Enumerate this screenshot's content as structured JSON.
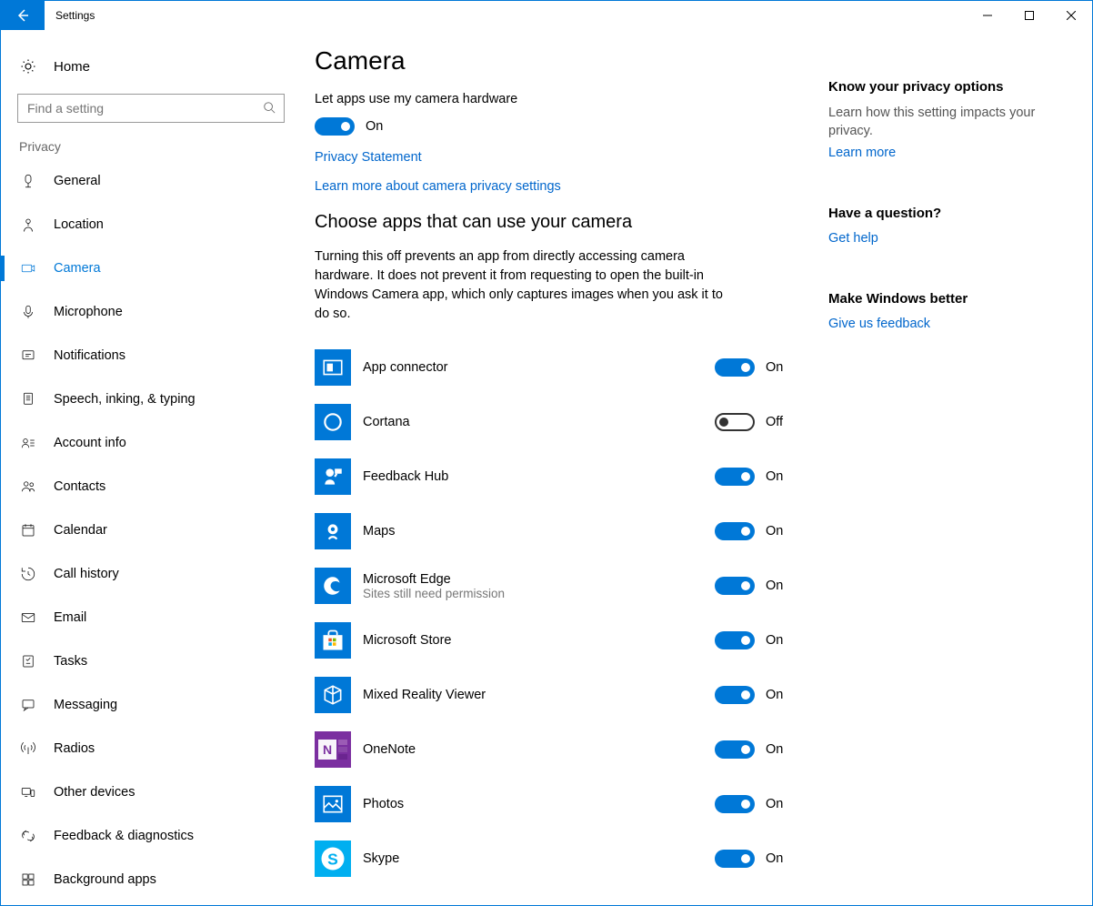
{
  "window": {
    "title": "Settings"
  },
  "sidebar": {
    "home": "Home",
    "search_placeholder": "Find a setting",
    "section": "Privacy",
    "items": [
      {
        "id": "general",
        "label": "General"
      },
      {
        "id": "location",
        "label": "Location"
      },
      {
        "id": "camera",
        "label": "Camera",
        "active": true
      },
      {
        "id": "microphone",
        "label": "Microphone"
      },
      {
        "id": "notifications",
        "label": "Notifications"
      },
      {
        "id": "speech",
        "label": "Speech, inking, & typing"
      },
      {
        "id": "accountinfo",
        "label": "Account info"
      },
      {
        "id": "contacts",
        "label": "Contacts"
      },
      {
        "id": "calendar",
        "label": "Calendar"
      },
      {
        "id": "callhistory",
        "label": "Call history"
      },
      {
        "id": "email",
        "label": "Email"
      },
      {
        "id": "tasks",
        "label": "Tasks"
      },
      {
        "id": "messaging",
        "label": "Messaging"
      },
      {
        "id": "radios",
        "label": "Radios"
      },
      {
        "id": "otherdevices",
        "label": "Other devices"
      },
      {
        "id": "feedback",
        "label": "Feedback & diagnostics"
      },
      {
        "id": "background",
        "label": "Background apps"
      }
    ]
  },
  "main": {
    "title": "Camera",
    "master_label": "Let apps use my camera hardware",
    "master_state": "On",
    "privacy_link": "Privacy Statement",
    "learn_link": "Learn more about camera privacy settings",
    "subhead": "Choose apps that can use your camera",
    "desc": "Turning this off prevents an app from directly accessing camera hardware. It does not prevent it from requesting to open the built-in Windows Camera app, which only captures images when you ask it to do so.",
    "apps": [
      {
        "name": "App connector",
        "state": "On",
        "color": "#0078d7"
      },
      {
        "name": "Cortana",
        "state": "Off",
        "color": "#0078d7"
      },
      {
        "name": "Feedback Hub",
        "state": "On",
        "color": "#0078d7"
      },
      {
        "name": "Maps",
        "state": "On",
        "color": "#0078d7"
      },
      {
        "name": "Microsoft Edge",
        "sub": "Sites still need permission",
        "state": "On",
        "color": "#0078d7"
      },
      {
        "name": "Microsoft Store",
        "state": "On",
        "color": "#0078d7"
      },
      {
        "name": "Mixed Reality Viewer",
        "state": "On",
        "color": "#0078d7"
      },
      {
        "name": "OneNote",
        "state": "On",
        "color": "#7b2fa0"
      },
      {
        "name": "Photos",
        "state": "On",
        "color": "#0078d7"
      },
      {
        "name": "Skype",
        "state": "On",
        "color": "#00aff0"
      }
    ]
  },
  "aside": {
    "s1_title": "Know your privacy options",
    "s1_body": "Learn how this setting impacts your privacy.",
    "s1_link": "Learn more",
    "s2_title": "Have a question?",
    "s2_link": "Get help",
    "s3_title": "Make Windows better",
    "s3_link": "Give us feedback"
  }
}
